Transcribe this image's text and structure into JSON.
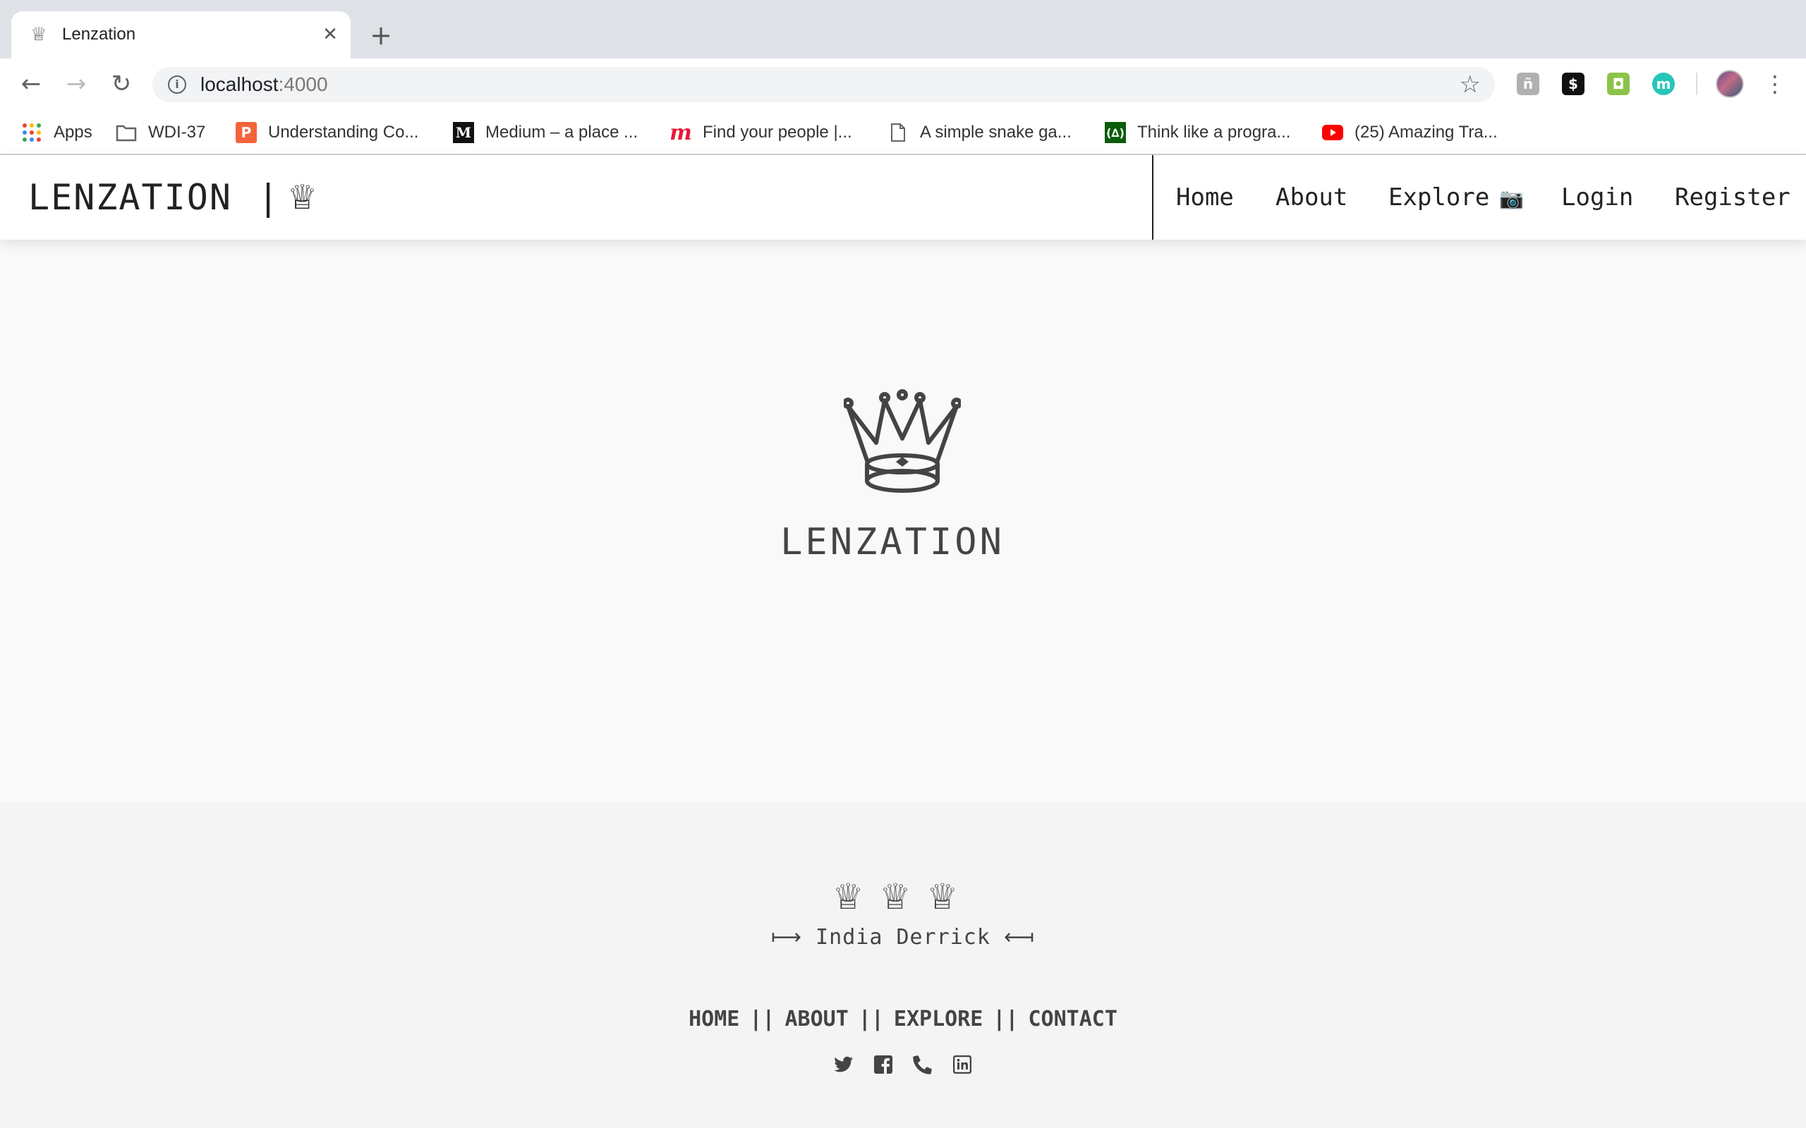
{
  "browser": {
    "tab": {
      "favicon": "crown-icon",
      "title": "Lenzation",
      "close": "✕"
    },
    "new_tab": "+",
    "nav": {
      "back": "←",
      "forward": "→",
      "reload": "↻"
    },
    "url_host": "localhost",
    "url_port": ":4000",
    "info": "i",
    "star": "☆",
    "extensions": [
      {
        "name": "extension-grey",
        "glyph": "ñ",
        "color": "#b0b0b0"
      },
      {
        "name": "extension-dollar",
        "glyph": "$",
        "color": "#111111"
      },
      {
        "name": "extension-shield",
        "glyph": "◘",
        "color": "#8bc34a"
      },
      {
        "name": "extension-m",
        "glyph": "m",
        "color": "#26c6b9"
      }
    ],
    "menu": "⋮",
    "bookmarks": [
      {
        "icon": "apps-grid-icon",
        "label": "Apps"
      },
      {
        "icon": "folder-icon",
        "label": "WDI-37"
      },
      {
        "icon": "p-icon",
        "label": "Understanding Co..."
      },
      {
        "icon": "medium-icon",
        "label": "Medium – a place ..."
      },
      {
        "icon": "meetup-icon",
        "label": "Find your people |..."
      },
      {
        "icon": "page-icon",
        "label": "A simple snake ga..."
      },
      {
        "icon": "freecodecamp-icon",
        "label": "Think like a progra..."
      },
      {
        "icon": "youtube-icon",
        "label": "(25) Amazing Tra..."
      }
    ]
  },
  "site": {
    "brand": "LENZATION",
    "brand_sep": "|",
    "brand_crown": "♕",
    "nav": {
      "home": "Home",
      "about": "About",
      "explore": "Explore",
      "explore_icon": "📷",
      "login": "Login",
      "register": "Register"
    },
    "hero": {
      "title": "LENZATION"
    },
    "footer": {
      "crowns": "♕♕♕",
      "author": "⟼ India Derrick ⟻",
      "links": {
        "home": "HOME",
        "about": "ABOUT",
        "explore": "EXPLORE",
        "contact": "CONTACT",
        "sep": "||"
      },
      "social": [
        "twitter-icon",
        "facebook-icon",
        "phone-icon",
        "linkedin-icon"
      ]
    }
  }
}
